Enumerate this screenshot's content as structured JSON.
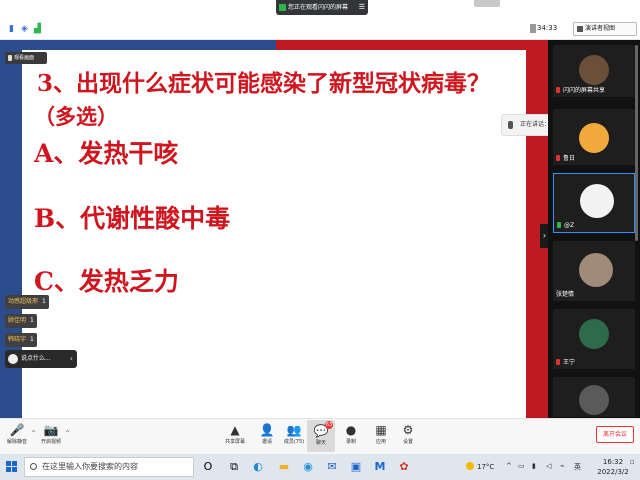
{
  "status_bar": {
    "share_banner": "您正在观看闪闪的屏幕",
    "menu_glyph": "☰",
    "timer": "34:33",
    "view_mode": "演讲者视图",
    "signal_icons": [
      "signal-icon",
      "shield-icon",
      "wifi-icon"
    ]
  },
  "slide": {
    "title": "3、出现什么症状可能感染了新型冠状病毒？",
    "multi": "（多选）",
    "options": [
      "A、发热干咳",
      "B、代谢性酸中毒",
      "C、发热乏力"
    ]
  },
  "overlays": {
    "viewing_tag": "观看画面",
    "reactions": [
      {
        "name": "动感超级邢",
        "count": "1"
      },
      {
        "name": "顾佳明",
        "count": "1"
      },
      {
        "name": "韩晓宇",
        "count": "1"
      }
    ],
    "chat_toast": "说点什么...",
    "chat_toast_arrow": "‹",
    "speaking_label": "正在讲话：@Z",
    "collapse_glyph": "›"
  },
  "participants": [
    {
      "name": "闪闪的屏幕共享",
      "avatar_color": "#6b4f3a"
    },
    {
      "name": "鲁日",
      "avatar_color": "#f2a93b"
    },
    {
      "name": "@Z",
      "avatar_color": "#f2f2f2"
    },
    {
      "name": "张楚情",
      "avatar_color": "#a08a78"
    },
    {
      "name": "王宁",
      "avatar_color": "#2e6b4a"
    },
    {
      "name": "",
      "avatar_color": "#5a5a5a"
    }
  ],
  "toolbar": {
    "left": [
      {
        "label": "解除静音",
        "glyph": "🎤"
      },
      {
        "label": "开启视频",
        "glyph": "📷"
      }
    ],
    "center": [
      {
        "label": "共享屏幕",
        "glyph": "▲"
      },
      {
        "label": "邀请",
        "glyph": "👤"
      },
      {
        "label": "成员(75)",
        "glyph": "👥"
      },
      {
        "label": "聊天",
        "glyph": "💬"
      },
      {
        "label": "录制",
        "glyph": "●"
      },
      {
        "label": "应用",
        "glyph": "▦"
      },
      {
        "label": "设置",
        "glyph": "⚙"
      }
    ],
    "chat_badge": "63",
    "leave": "离开会议",
    "caret": "^"
  },
  "taskbar": {
    "search_placeholder": "在这里输入你要搜索的内容",
    "apps": [
      {
        "name": "search-app-icon",
        "glyph": "O",
        "color": "#333333"
      },
      {
        "name": "task-view-icon",
        "glyph": "⧉",
        "color": "#333333"
      },
      {
        "name": "edge-icon",
        "glyph": "◐",
        "color": "#1f8ad6"
      },
      {
        "name": "file-explorer-icon",
        "glyph": "▬",
        "color": "#f2b01e"
      },
      {
        "name": "browser-icon",
        "glyph": "◉",
        "color": "#1e90d6"
      },
      {
        "name": "mail-icon",
        "glyph": "✉",
        "color": "#1a66c9"
      },
      {
        "name": "store-icon",
        "glyph": "▣",
        "color": "#1a66c9"
      },
      {
        "name": "meeting-icon",
        "glyph": "M",
        "color": "#1a66c9"
      },
      {
        "name": "media-icon",
        "glyph": "✿",
        "color": "#d33a2c"
      }
    ],
    "weather": "17°C",
    "tray_arrow": "^",
    "ime": "英",
    "time": "16:32",
    "date": "2022/3/2"
  }
}
